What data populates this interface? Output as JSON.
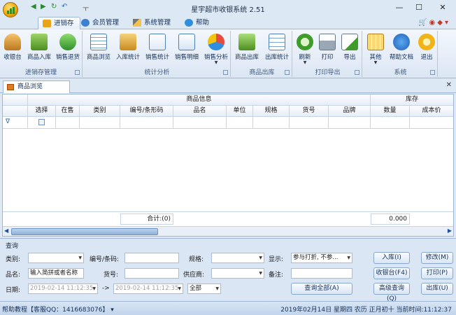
{
  "titlebar": {
    "title": "星宇超市收银系统 2.51",
    "pin": "ㅜ"
  },
  "ribbon_tabs": [
    {
      "label": "进销存",
      "active": true
    },
    {
      "label": "会员管理"
    },
    {
      "label": "系统管理"
    },
    {
      "label": "帮助"
    }
  ],
  "groups": [
    {
      "label": "进销存管理",
      "buttons": [
        "收银台",
        "商品入库",
        "销售退货"
      ]
    },
    {
      "label": "统计分析",
      "buttons": [
        "商品浏览",
        "入库统计",
        "销售统计",
        "销售明细",
        "销售分析"
      ]
    },
    {
      "label": "商品出库",
      "buttons": [
        "商品出库",
        "出库统计"
      ]
    },
    {
      "label": "打印导出",
      "buttons": [
        "刷新",
        "打印",
        "导出"
      ]
    },
    {
      "label": "系统",
      "buttons": [
        "其他",
        "帮助文档",
        "退出"
      ]
    }
  ],
  "doc_tab": {
    "label": "商品浏览"
  },
  "grid": {
    "band_product": "商品信息",
    "band_stock": "库存",
    "columns": [
      "选择",
      "在售",
      "类别",
      "编号/条形码",
      "品名",
      "单位",
      "规格",
      "货号",
      "品牌",
      "数量",
      "成本价"
    ],
    "filter_symbol": "∇",
    "total_label": "合计:(0)",
    "total_value": "0.000"
  },
  "query": {
    "title": "查询",
    "category_label": "类别:",
    "code_label": "编号/条码:",
    "spec_label": "规格:",
    "display_label": "显示:",
    "display_value": "参与打折, 不参...",
    "name_label": "品名:",
    "name_placeholder": "输入简拼或者名称",
    "itemno_label": "货号:",
    "supplier_label": "供应商:",
    "note_label": "备注:",
    "date_label": "日期:",
    "date_from": "2019-02-14 11:12:35",
    "date_sep": "->",
    "date_to": "2019-02-14 11:12:35",
    "range_value": "全部",
    "query_all_button": "查询全部(A)",
    "buttons": {
      "in": "入库(I)",
      "edit": "修改(M)",
      "pos": "收银台(F4)",
      "print": "打印(P)",
      "advanced": "高级查询(Q)",
      "out": "出库(U)"
    }
  },
  "status": {
    "left": "帮助教程【客服QQ：1416683076】 ▾",
    "right": "2019年02月14日 星期四 农历 正月初十 当前时间:11:12:37"
  }
}
